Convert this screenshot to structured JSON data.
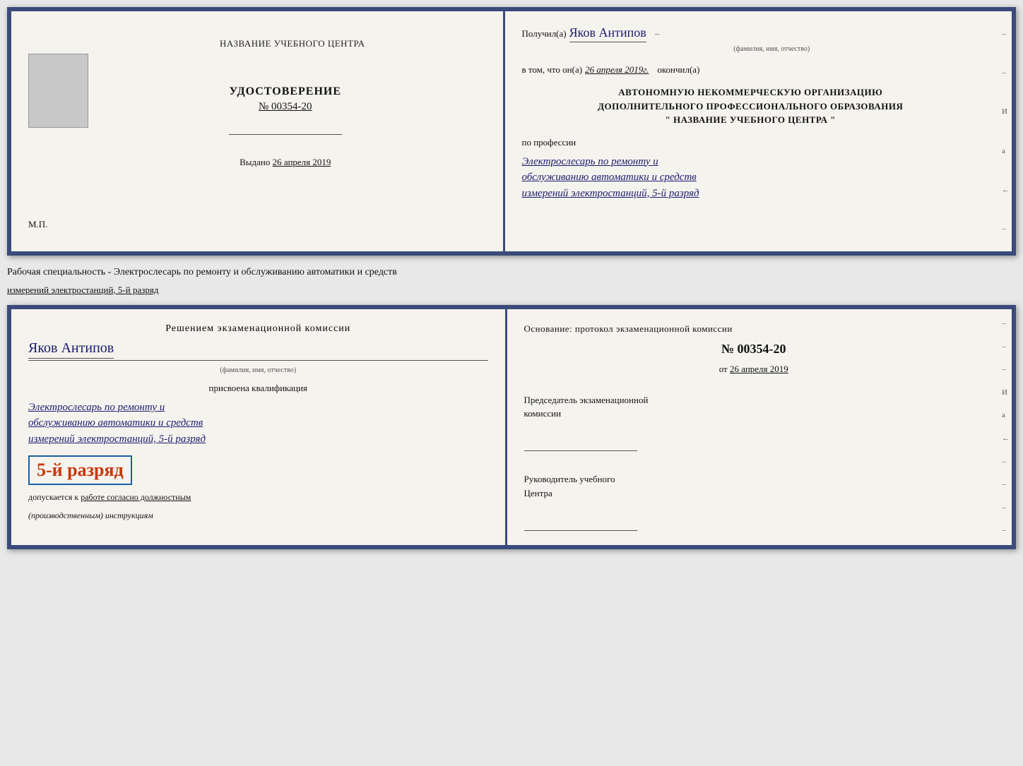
{
  "top_doc": {
    "left_page": {
      "header": "НАЗВАНИЕ УЧЕБНОГО ЦЕНТРА",
      "cert_title": "УДОСТОВЕРЕНИЕ",
      "cert_number": "№ 00354-20",
      "issued_prefix": "Выдано",
      "issued_date": "26 апреля 2019",
      "mp_label": "М.П."
    },
    "right_page": {
      "received_prefix": "Получил(а)",
      "received_name": "Яков Антипов",
      "fio_label": "(фамилия, имя, отчество)",
      "certifies_prefix": "в том, что он(а)",
      "certifies_date": "26 апреля 2019г.",
      "certifies_suffix": "окончил(а)",
      "org_line1": "АВТОНОМНУЮ НЕКОММЕРЧЕСКУЮ ОРГАНИЗАЦИЮ",
      "org_line2": "ДОПОЛНИТЕЛЬНОГО ПРОФЕССИОНАЛЬНОГО ОБРАЗОВАНИЯ",
      "org_line3": "\"   НАЗВАНИЕ УЧЕБНОГО ЦЕНТРА   \"",
      "profession_label": "по профессии",
      "profession_line1": "Электрослесарь по ремонту и",
      "profession_line2": "обслуживанию автоматики и средств",
      "profession_line3": "измерений электростанций, 5-й разряд",
      "right_marks": [
        "И",
        "а",
        "←",
        "–",
        "–",
        "–"
      ]
    }
  },
  "separator": {
    "text": "Рабочая специальность - Электрослесарь по ремонту и обслуживанию автоматики и средств",
    "text2": "измерений электростанций, 5-й разряд"
  },
  "bottom_doc": {
    "left_page": {
      "decision_title": "Решением экзаменационной комиссии",
      "person_name": "Яков Антипов",
      "fio_label": "(фамилия, имя, отчество)",
      "qualification_label": "присвоена квалификация",
      "qual_line1": "Электрослесарь по ремонту и",
      "qual_line2": "обслуживанию автоматики и средств",
      "qual_line3": "измерений электростанций, 5-й разряд",
      "grade_text": "5-й разряд",
      "allowed_prefix": "допускается к",
      "allowed_text": "работе согласно должностным",
      "allowed_italic": "(производственным) инструкциям"
    },
    "right_page": {
      "basis_label": "Основание: протокол экзаменационной комиссии",
      "number_prefix": "№",
      "number": "00354-20",
      "date_prefix": "от",
      "date": "26 апреля 2019",
      "chairman_title": "Председатель экзаменационной",
      "chairman_title2": "комиссии",
      "director_title": "Руководитель учебного",
      "director_title2": "Центра",
      "right_marks": [
        "–",
        "–",
        "–",
        "И",
        "а",
        "←",
        "–",
        "–",
        "–",
        "–"
      ]
    }
  }
}
